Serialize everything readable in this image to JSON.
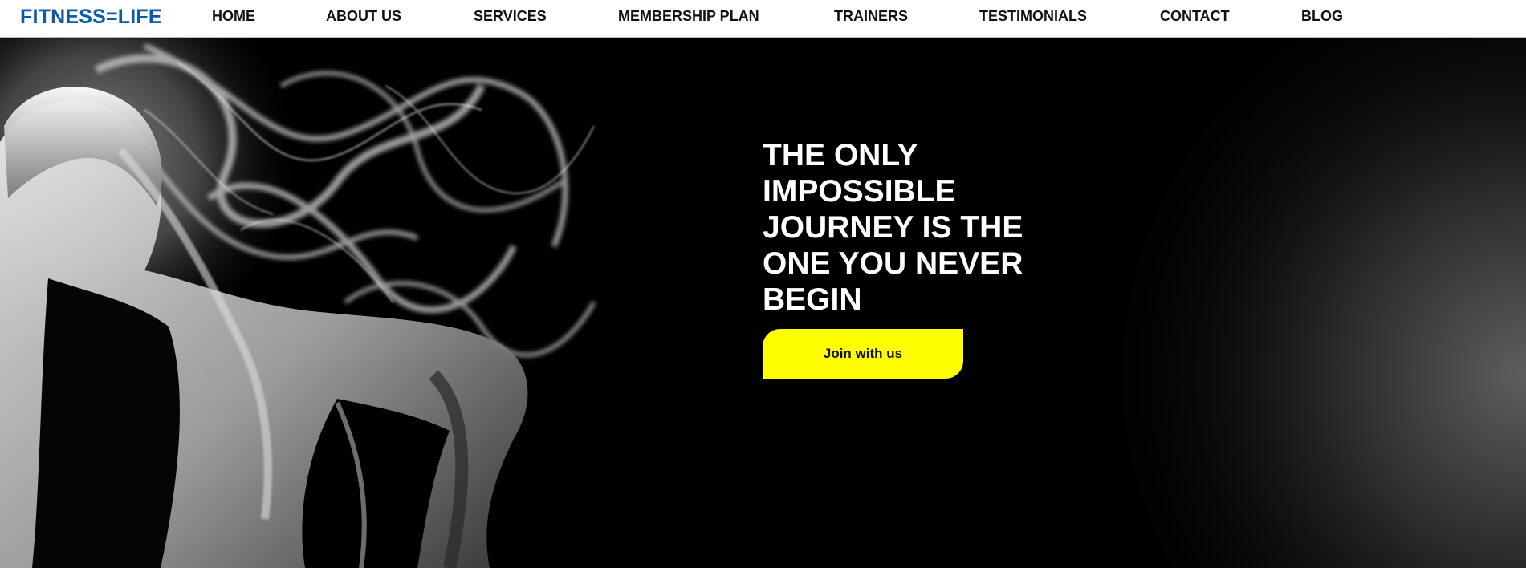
{
  "nav": {
    "brand": "FITNESS=LIFE",
    "items": [
      {
        "label": "HOME"
      },
      {
        "label": "ABOUT US"
      },
      {
        "label": "SERVICES"
      },
      {
        "label": "MEMBERSHIP PLAN"
      },
      {
        "label": "TRAINERS"
      },
      {
        "label": "TESTIMONIALS"
      },
      {
        "label": "CONTACT"
      },
      {
        "label": "BLOG"
      }
    ]
  },
  "hero": {
    "headline": "THE ONLY\nIMPOSSIBLE\nJOURNEY IS THE\nONE YOU NEVER\nBEGIN",
    "cta_label": "Join with us"
  },
  "colors": {
    "brand": "#0d5aa6",
    "accent": "#ffff00",
    "hero_background": "#000000",
    "nav_background": "#ffffff"
  }
}
